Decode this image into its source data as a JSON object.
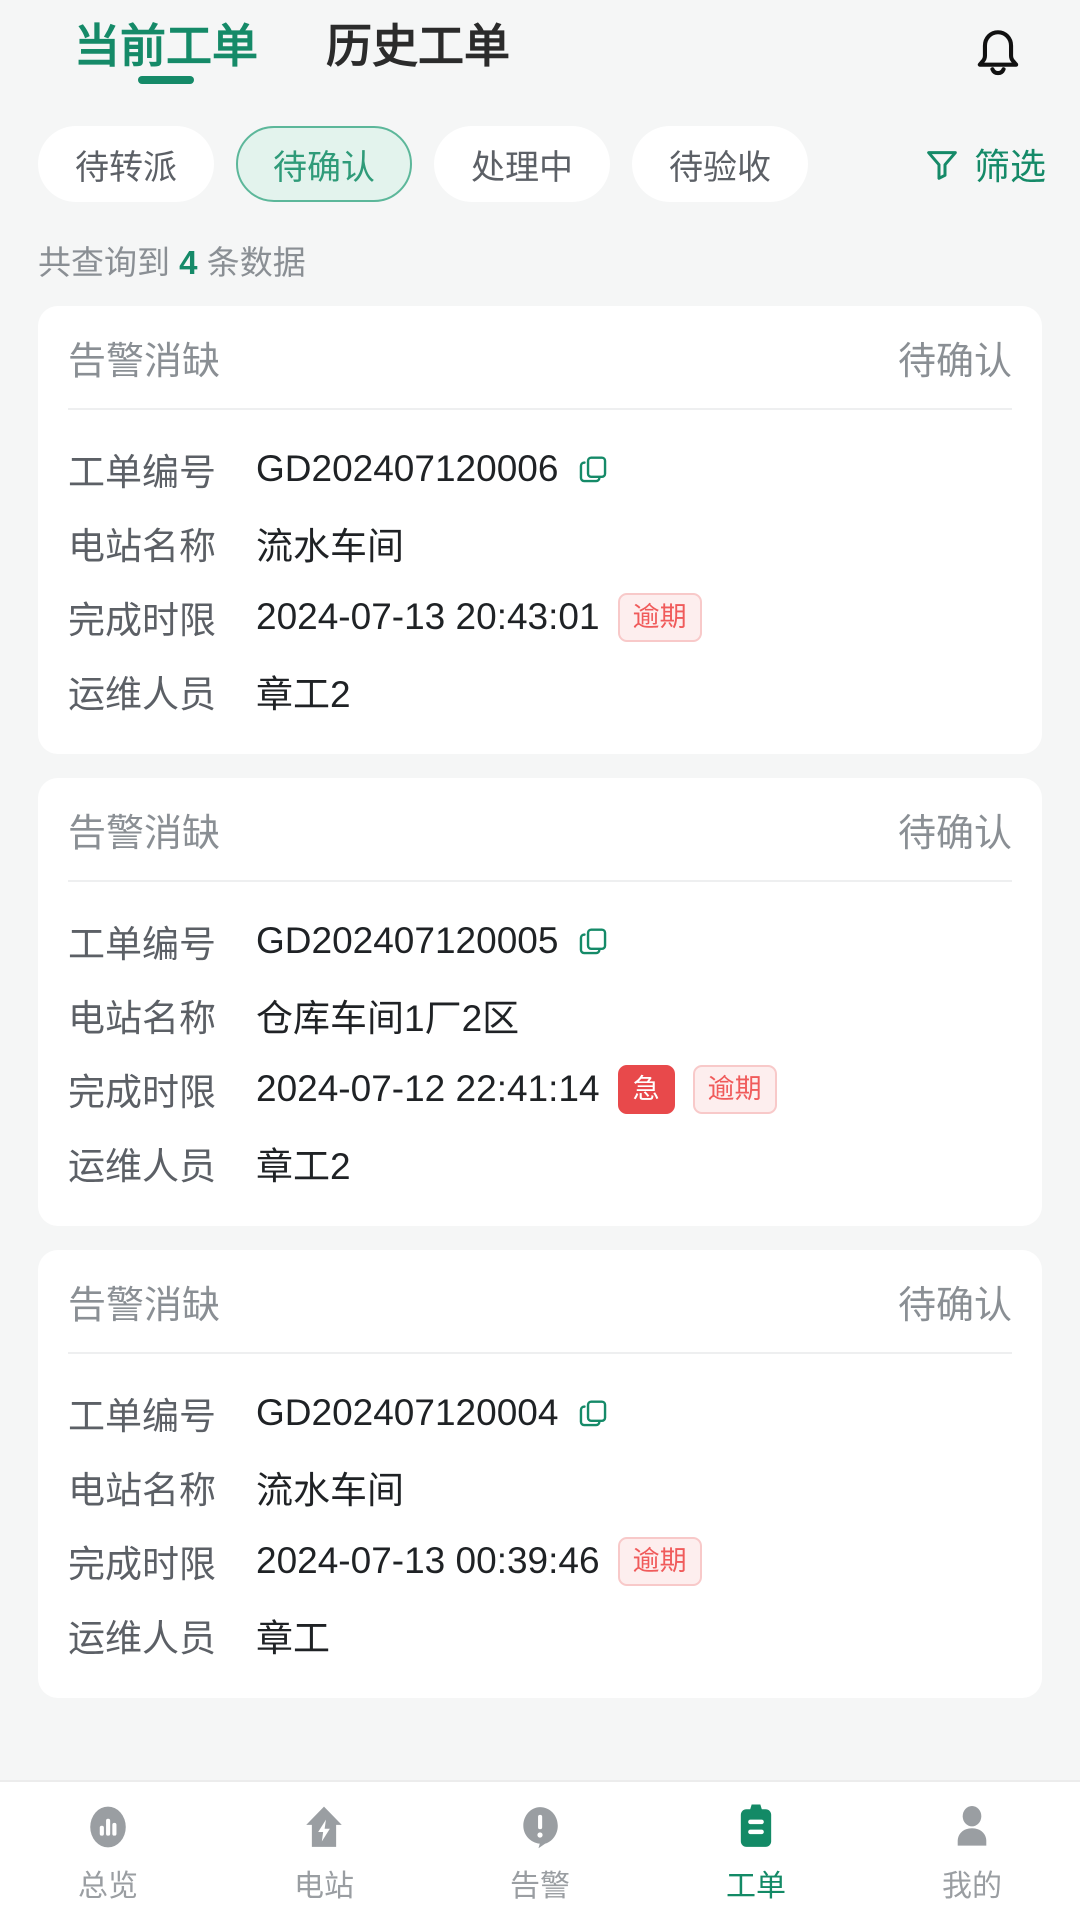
{
  "theme": {
    "accent": "#158a68",
    "chip_selected_bg": "#e3f3ed",
    "chip_selected_border": "#5cb79a",
    "overdue_color": "#f05b5b",
    "overdue_bg": "#fdeeee",
    "urgent_bg": "#e8494b",
    "page_bg": "#f5f6f6",
    "card_bg": "#ffffff"
  },
  "header": {
    "tabs": [
      {
        "label": "当前工单",
        "active": true
      },
      {
        "label": "历史工单",
        "active": false
      }
    ],
    "notification_icon": "bell-icon"
  },
  "filters": {
    "chips": [
      {
        "label": "待转派",
        "selected": false
      },
      {
        "label": "待确认",
        "selected": true
      },
      {
        "label": "处理中",
        "selected": false
      },
      {
        "label": "待验收",
        "selected": false
      }
    ],
    "filter_button": {
      "label": "筛选",
      "icon": "funnel-icon"
    }
  },
  "summary": {
    "prefix": "共查询到",
    "count": "4",
    "suffix": "条数据"
  },
  "labels": {
    "order_no": "工单编号",
    "station_name": "电站名称",
    "deadline": "完成时限",
    "operator": "运维人员",
    "copy_icon": "copy-icon"
  },
  "cards": [
    {
      "type": "告警消缺",
      "status": "待确认",
      "order_no": "GD202407120006",
      "station_name": "流水车间",
      "deadline": "2024-07-13 20:43:01",
      "badges": [
        {
          "text": "逾期",
          "kind": "overdue"
        }
      ],
      "operator": "章工2"
    },
    {
      "type": "告警消缺",
      "status": "待确认",
      "order_no": "GD202407120005",
      "station_name": "仓库车间1厂2区",
      "deadline": "2024-07-12 22:41:14",
      "badges": [
        {
          "text": "急",
          "kind": "urgent"
        },
        {
          "text": "逾期",
          "kind": "overdue"
        }
      ],
      "operator": "章工2"
    },
    {
      "type": "告警消缺",
      "status": "待确认",
      "order_no": "GD202407120004",
      "station_name": "流水车间",
      "deadline": "2024-07-13 00:39:46",
      "badges": [
        {
          "text": "逾期",
          "kind": "overdue"
        }
      ],
      "operator": "章工"
    }
  ],
  "bottom_nav": [
    {
      "label": "总览",
      "icon": "chart-icon",
      "active": false
    },
    {
      "label": "电站",
      "icon": "power-station-icon",
      "active": false
    },
    {
      "label": "告警",
      "icon": "alert-icon",
      "active": false
    },
    {
      "label": "工单",
      "icon": "clipboard-icon",
      "active": true
    },
    {
      "label": "我的",
      "icon": "person-icon",
      "active": false
    }
  ]
}
